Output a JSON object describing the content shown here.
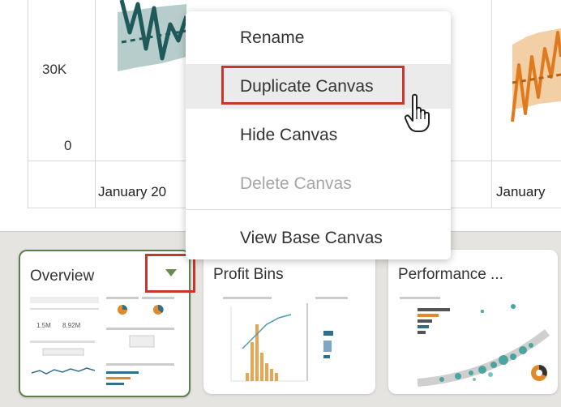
{
  "chart": {
    "y_ticks": [
      "30K",
      "0"
    ],
    "x_labels": [
      "January 20",
      "January"
    ],
    "colors": {
      "series_left": "#1f5a5a",
      "band_left": "#b7cdcb",
      "series_right": "#e07a1f",
      "band_right": "#f3cfa6"
    }
  },
  "context_menu": {
    "items": [
      {
        "label": "Rename",
        "state": "normal"
      },
      {
        "label": "Duplicate Canvas",
        "state": "hover"
      },
      {
        "label": "Hide Canvas",
        "state": "normal"
      },
      {
        "label": "Delete Canvas",
        "state": "disabled"
      },
      {
        "label": "View Base Canvas",
        "state": "normal"
      }
    ],
    "annotation_color": "#c7372c"
  },
  "canvas_tabs": [
    {
      "title": "Overview",
      "active": true
    },
    {
      "title": "Profit Bins",
      "active": false
    },
    {
      "title": "Performance ...",
      "active": false
    }
  ],
  "thumb_overview": {
    "kpi_a": "1.5M",
    "kpi_b": "8.92M"
  },
  "icons": {
    "cursor": "hand-pointer-icon",
    "tab_menu": "chevron-down-icon"
  }
}
